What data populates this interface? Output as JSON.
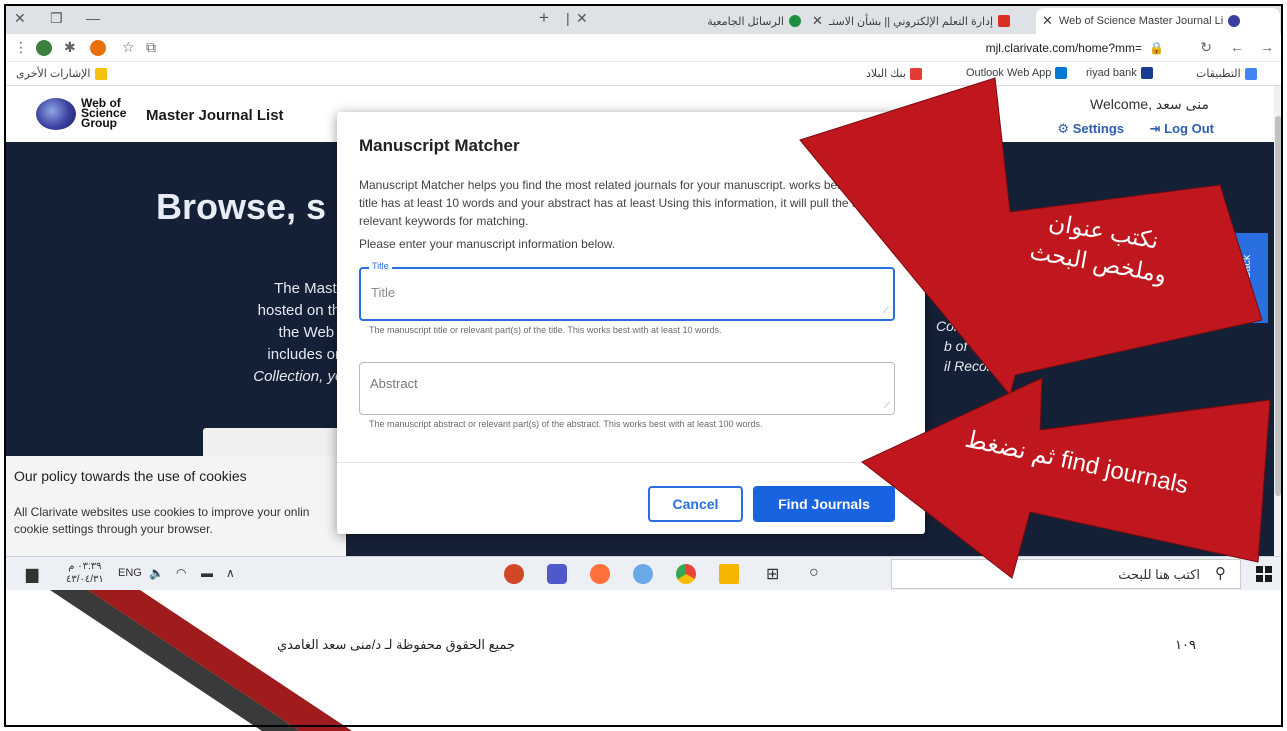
{
  "browser": {
    "tabs": [
      {
        "label": "Web of Science Master Journal Li",
        "active": true,
        "favicon_color": "#3b3f9e"
      },
      {
        "label": "إدارة التعلم الإلكتروني || بشأن الاستـ",
        "active": false,
        "favicon_color": "#d93025"
      },
      {
        "label": "الرسائل الجامعية",
        "active": false,
        "favicon_color": "#1e8e3e"
      }
    ],
    "new_tab_label": "+",
    "url": "mjl.clarivate.com/home?mm=",
    "bookmarks": [
      {
        "label": "التطبيقات",
        "icon_color": "#4285f4"
      },
      {
        "label": "riyad bank",
        "icon_color": "#1a3c8f"
      },
      {
        "label": "Outlook Web App",
        "icon_color": "#0078d4"
      },
      {
        "label": "بنك البلاد",
        "icon_color": "#e53935"
      }
    ],
    "other_bookmarks": "الإشارات الأخرى"
  },
  "site": {
    "logo_lines": [
      "Web of",
      "Science",
      "Group"
    ],
    "title": "Master Journal List",
    "welcome": "Welcome, منى سعد",
    "settings": "Settings",
    "logout": "Log Out",
    "hero_title": "Browse, s",
    "hero_lines": [
      "The Master Journa",
      "hosted on the Web of",
      "the Web of Scienc",
      "includes only journa",
      "Collection, you can se"
    ],
    "right_lines": [
      "Core Co",
      "b of     ce Core",
      "il Record,"
    ],
    "feedback": "Feedback"
  },
  "cookie": {
    "title": "Our policy towards the use of cookies",
    "text": "All Clarivate websites use cookies to improve your onlin cookie settings through your browser."
  },
  "modal": {
    "title": "Manuscript Matcher",
    "description": "Manuscript Matcher helps you find the most related journals for your manuscript. works best when your title has at least 10 words and your abstract has at least Using this information, it will pull the most relevant keywords for matching.",
    "prompt": "Please enter your manuscript information below.",
    "title_label": "Title",
    "title_placeholder": "Title",
    "title_help": "The manuscript title or relevant part(s) of the title. This works best with at least 10 words.",
    "abstract_placeholder": "Abstract",
    "abstract_help": "The manuscript abstract or relevant part(s) of the abstract. This works best with at least 100 words.",
    "cancel": "Cancel",
    "find": "Find Journals"
  },
  "taskbar": {
    "search_text": "اكتب هنا للبحث",
    "time": "٠٣:٣٩ م",
    "date": "٤٣/٠٤/٣١",
    "lang": "ENG"
  },
  "annotations": {
    "top": "نكتب عنوان وملخص البحث",
    "bottom": "ثم نضغط find journals",
    "arrow_color": "#c0171f"
  },
  "footer": {
    "credit": "جميع الحقوق محفوظة لـ د/منى سعد الغامدي",
    "page_number": "١٠٩"
  }
}
